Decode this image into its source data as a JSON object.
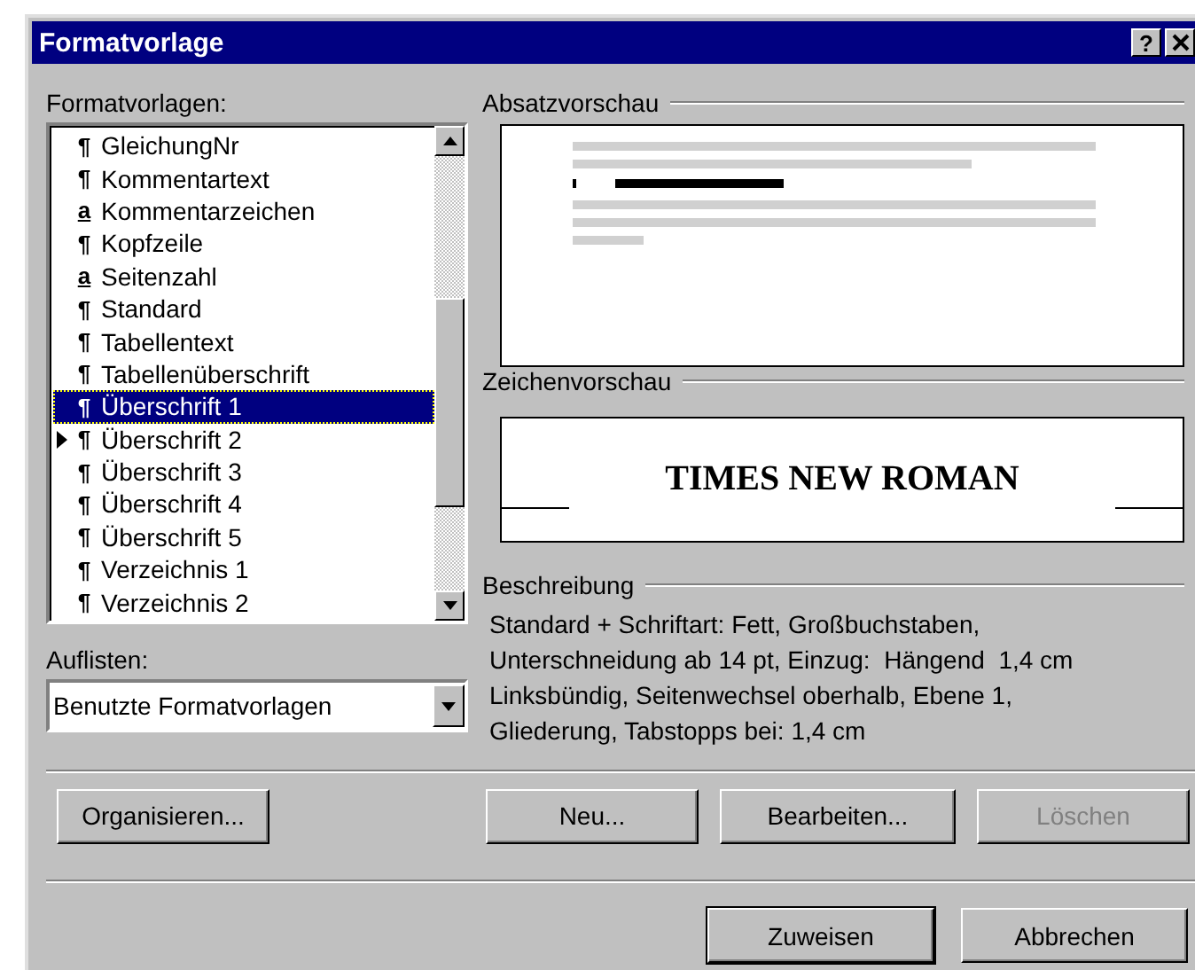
{
  "window": {
    "title": "Formatvorlage",
    "help_button": "?"
  },
  "styles_label": "Formatvorlagen:",
  "styles": [
    {
      "name": "GleichungNr",
      "kind": "paragraph",
      "symbol": "¶",
      "selected": false,
      "current": false
    },
    {
      "name": "Kommentartext",
      "kind": "paragraph",
      "symbol": "¶",
      "selected": false,
      "current": false
    },
    {
      "name": "Kommentarzeichen",
      "kind": "character",
      "symbol": "a",
      "selected": false,
      "current": false
    },
    {
      "name": "Kopfzeile",
      "kind": "paragraph",
      "symbol": "¶",
      "selected": false,
      "current": false
    },
    {
      "name": "Seitenzahl",
      "kind": "character",
      "symbol": "a",
      "selected": false,
      "current": false
    },
    {
      "name": "Standard",
      "kind": "paragraph",
      "symbol": "¶",
      "selected": false,
      "current": false
    },
    {
      "name": "Tabellentext",
      "kind": "paragraph",
      "symbol": "¶",
      "selected": false,
      "current": false
    },
    {
      "name": "Tabellenüberschrift",
      "kind": "paragraph",
      "symbol": "¶",
      "selected": false,
      "current": false
    },
    {
      "name": "Überschrift 1",
      "kind": "paragraph",
      "symbol": "¶",
      "selected": true,
      "current": false
    },
    {
      "name": "Überschrift 2",
      "kind": "paragraph",
      "symbol": "¶",
      "selected": false,
      "current": true
    },
    {
      "name": "Überschrift 3",
      "kind": "paragraph",
      "symbol": "¶",
      "selected": false,
      "current": false
    },
    {
      "name": "Überschrift 4",
      "kind": "paragraph",
      "symbol": "¶",
      "selected": false,
      "current": false
    },
    {
      "name": "Überschrift 5",
      "kind": "paragraph",
      "symbol": "¶",
      "selected": false,
      "current": false
    },
    {
      "name": "Verzeichnis 1",
      "kind": "paragraph",
      "symbol": "¶",
      "selected": false,
      "current": false
    },
    {
      "name": "Verzeichnis 2",
      "kind": "paragraph",
      "symbol": "¶",
      "selected": false,
      "current": false
    }
  ],
  "list_label": "Auflisten:",
  "list_combo": {
    "value": "Benutzte Formatvorlagen"
  },
  "paragraph_preview": {
    "label": "Absatzvorschau"
  },
  "character_preview": {
    "label": "Zeichenvorschau",
    "sample": "TIMES NEW ROMAN"
  },
  "description": {
    "label": "Beschreibung",
    "lines": [
      "Standard + Schriftart: Fett, Großbuchstaben,",
      "Unterschneidung ab 14 pt, Einzug:  Hängend  1,4 cm",
      "Linksbündig, Seitenwechsel oberhalb, Ebene 1,",
      "Gliederung, Tabstopps bei: 1,4 cm"
    ]
  },
  "buttons": [
    {
      "label": "Organisieren...",
      "disabled": false
    },
    {
      "label": "Neu...",
      "disabled": false
    },
    {
      "label": "Bearbeiten...",
      "disabled": false
    },
    {
      "label": "Löschen",
      "disabled": true
    }
  ],
  "footer_buttons": [
    {
      "label": "Zuweisen",
      "default": true
    },
    {
      "label": "Abbrechen",
      "default": false
    }
  ]
}
